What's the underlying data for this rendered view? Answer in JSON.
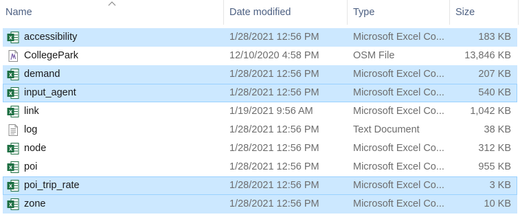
{
  "columns": {
    "name": "Name",
    "date": "Date modified",
    "type": "Type",
    "size": "Size"
  },
  "files": [
    {
      "name": "accessibility",
      "date": "1/28/2021 12:56 PM",
      "type": "Microsoft Excel Co...",
      "size": "183 KB",
      "icon": "excel-icon",
      "selected": true,
      "focused": false
    },
    {
      "name": "CollegePark",
      "date": "12/10/2020 4:58 PM",
      "type": "OSM File",
      "size": "13,846 KB",
      "icon": "osm-file-icon",
      "selected": false,
      "focused": false
    },
    {
      "name": "demand",
      "date": "1/28/2021 12:56 PM",
      "type": "Microsoft Excel Co...",
      "size": "207 KB",
      "icon": "excel-icon",
      "selected": true,
      "focused": false
    },
    {
      "name": "input_agent",
      "date": "1/28/2021 12:56 PM",
      "type": "Microsoft Excel Co...",
      "size": "540 KB",
      "icon": "excel-icon",
      "selected": true,
      "focused": true
    },
    {
      "name": "link",
      "date": "1/19/2021 9:56 AM",
      "type": "Microsoft Excel Co...",
      "size": "1,042 KB",
      "icon": "excel-icon",
      "selected": false,
      "focused": false
    },
    {
      "name": "log",
      "date": "1/28/2021 12:56 PM",
      "type": "Text Document",
      "size": "38 KB",
      "icon": "text-document-icon",
      "selected": false,
      "focused": false
    },
    {
      "name": "node",
      "date": "1/28/2021 12:56 PM",
      "type": "Microsoft Excel Co...",
      "size": "312 KB",
      "icon": "excel-icon",
      "selected": false,
      "focused": false
    },
    {
      "name": "poi",
      "date": "1/28/2021 12:56 PM",
      "type": "Microsoft Excel Co...",
      "size": "955 KB",
      "icon": "excel-icon",
      "selected": false,
      "focused": false
    },
    {
      "name": "poi_trip_rate",
      "date": "1/28/2021 12:56 PM",
      "type": "Microsoft Excel Co...",
      "size": "3 KB",
      "icon": "excel-icon",
      "selected": true,
      "focused": true
    },
    {
      "name": "zone",
      "date": "1/28/2021 12:56 PM",
      "type": "Microsoft Excel Co...",
      "size": "10 KB",
      "icon": "excel-icon",
      "selected": true,
      "focused": false
    }
  ],
  "colors": {
    "selection": "#cce8ff",
    "focus_border": "#99d1ff",
    "header_text": "#4d6082",
    "excel_green": "#1d6f42"
  }
}
